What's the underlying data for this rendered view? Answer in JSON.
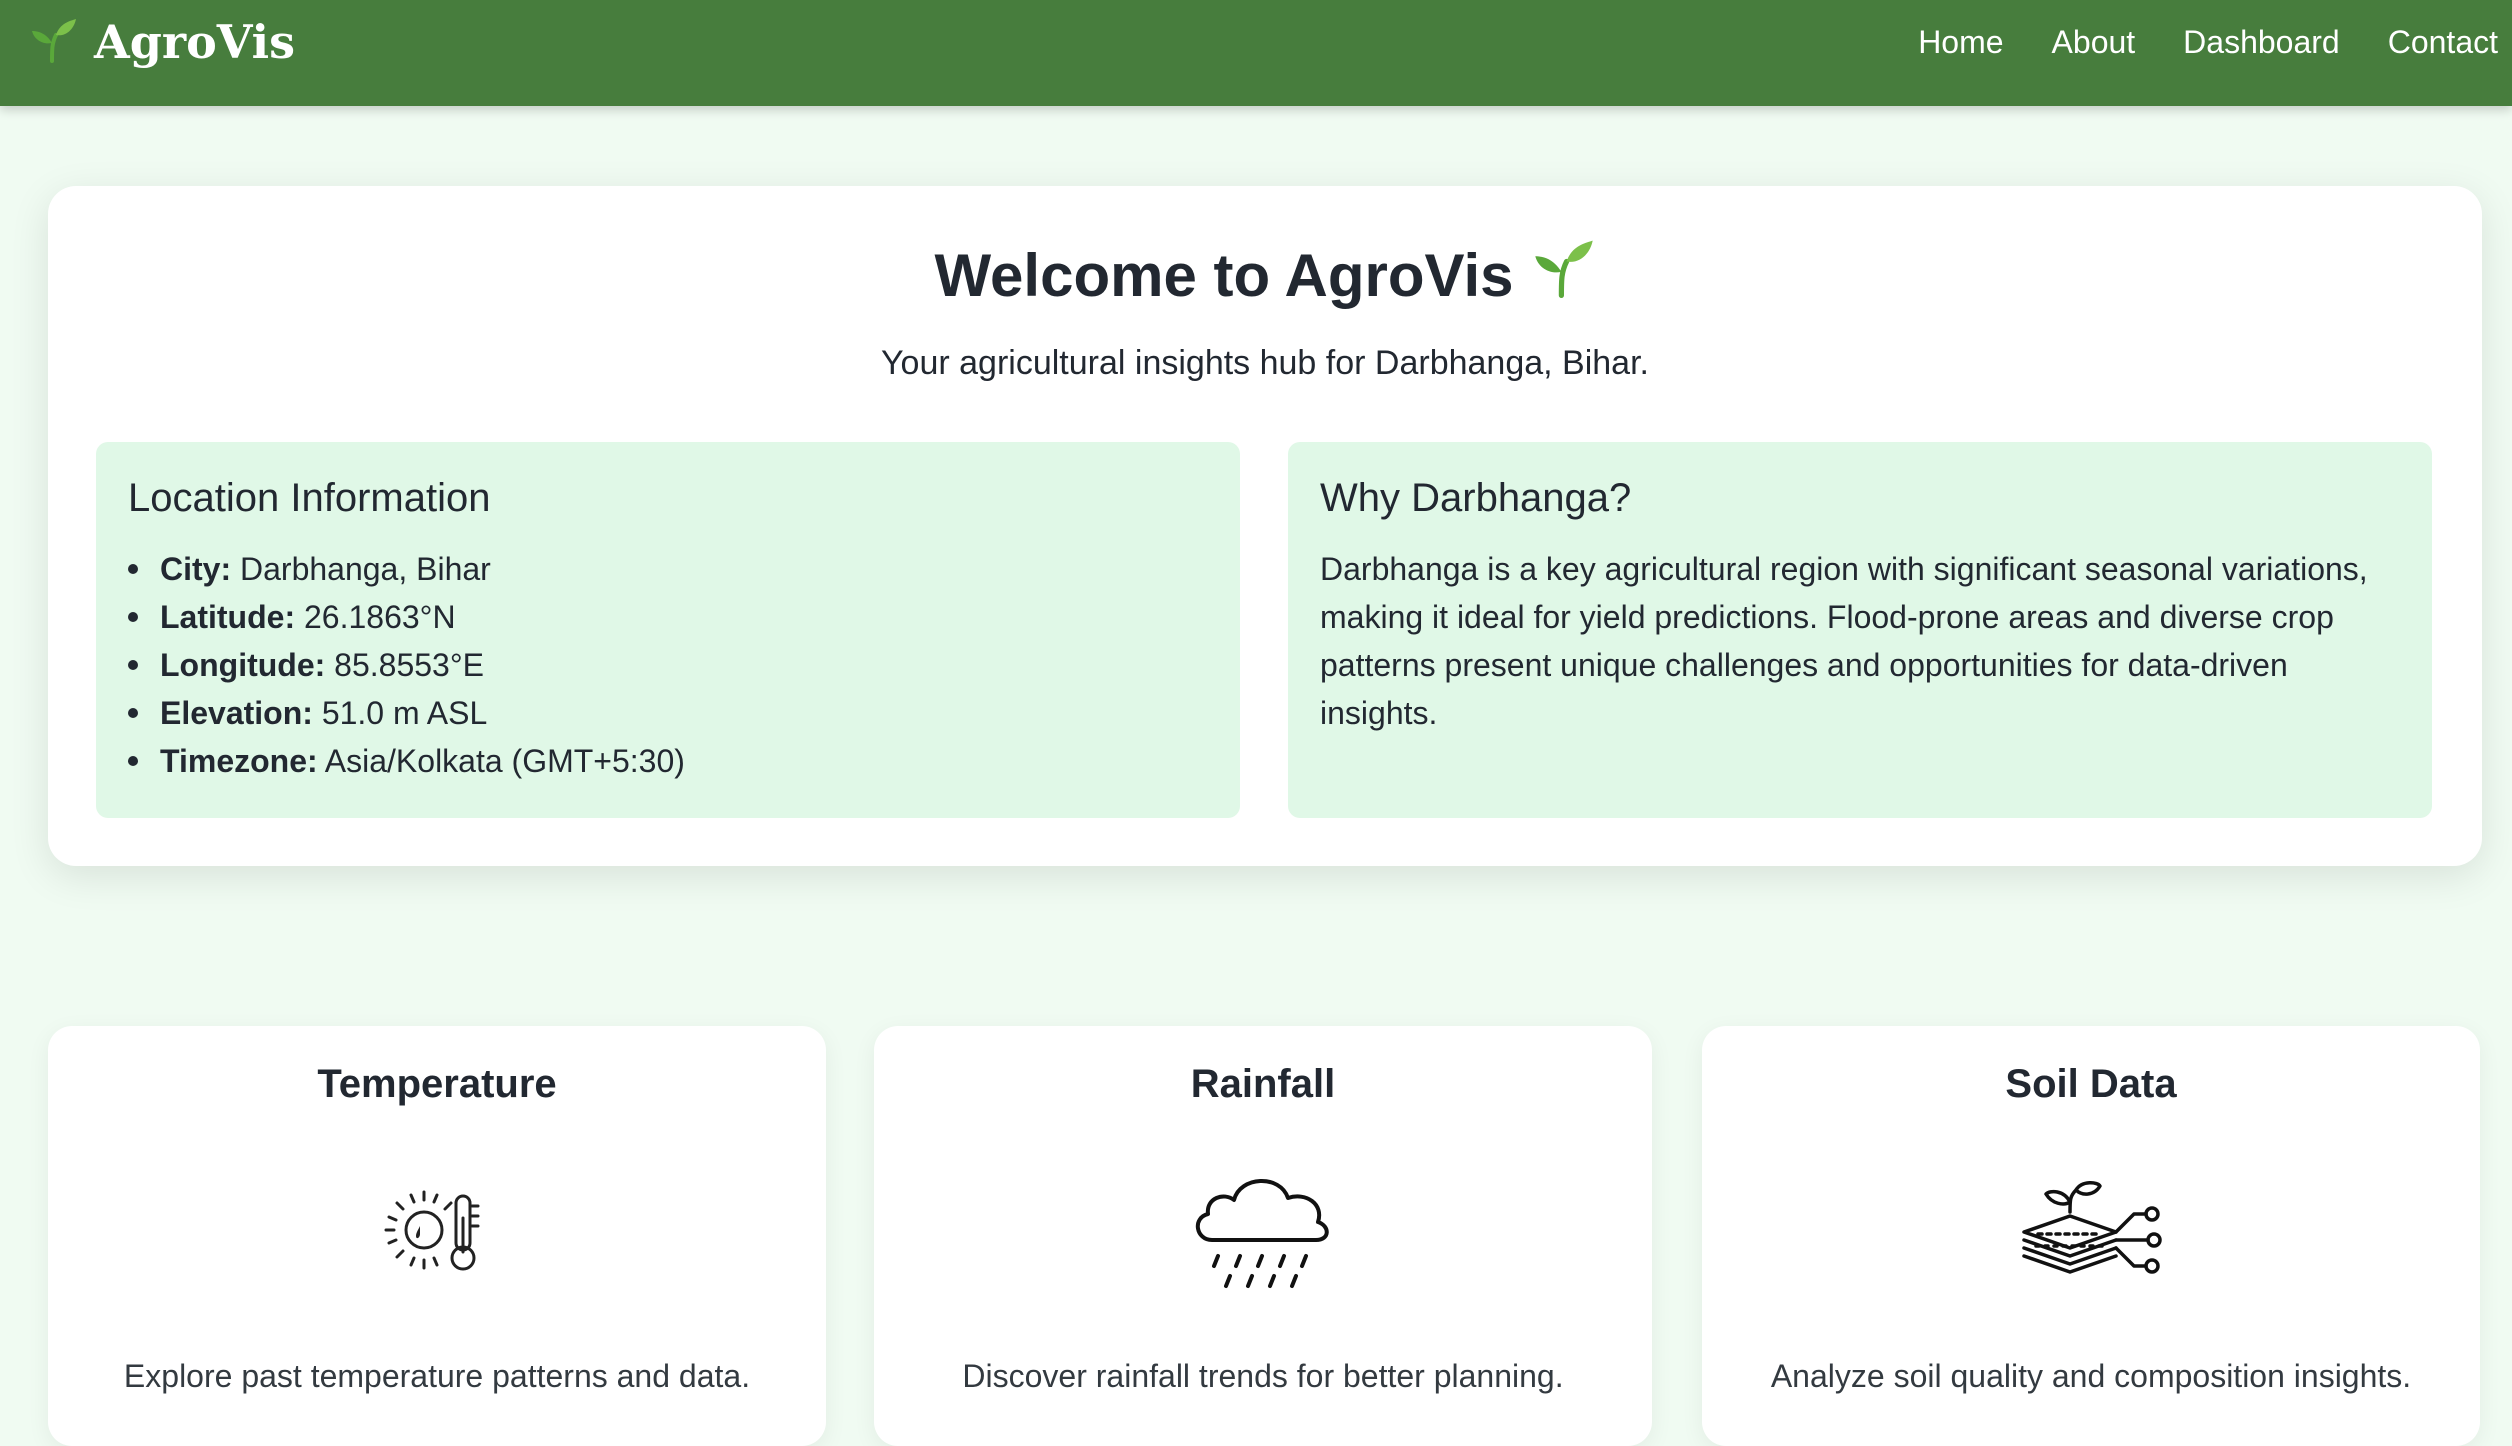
{
  "navbar": {
    "brand": "AgroVis",
    "brand_icon": "seedling-icon",
    "links": [
      "Home",
      "About",
      "Dashboard",
      "Contact"
    ]
  },
  "hero": {
    "title": "Welcome to AgroVis",
    "title_icon": "seedling-icon",
    "subtitle": "Your agricultural insights hub for Darbhanga, Bihar.",
    "location": {
      "heading": "Location Information",
      "items": [
        {
          "label": "City:",
          "value": "Darbhanga, Bihar"
        },
        {
          "label": "Latitude:",
          "value": "26.1863°N"
        },
        {
          "label": "Longitude:",
          "value": "85.8553°E"
        },
        {
          "label": "Elevation:",
          "value": "51.0 m ASL"
        },
        {
          "label": "Timezone:",
          "value": "Asia/Kolkata (GMT+5:30)"
        }
      ]
    },
    "why": {
      "heading": "Why Darbhanga?",
      "text": "Darbhanga is a key agricultural region with significant seasonal variations, making it ideal for yield predictions. Flood-prone areas and diverse crop patterns present unique challenges and opportunities for data-driven insights."
    }
  },
  "features": [
    {
      "title": "Temperature",
      "icon": "temperature-icon",
      "desc": "Explore past temperature patterns and data."
    },
    {
      "title": "Rainfall",
      "icon": "rain-cloud-icon",
      "desc": "Discover rainfall trends for better planning."
    },
    {
      "title": "Soil Data",
      "icon": "soil-layers-icon",
      "desc": "Analyze soil quality and composition insights."
    }
  ],
  "colors": {
    "navbar": "#477d3d",
    "page_bg": "#f0fbf2",
    "info_bg": "#e0f8e7",
    "text": "#222831",
    "seedling": "#5aa83a"
  }
}
